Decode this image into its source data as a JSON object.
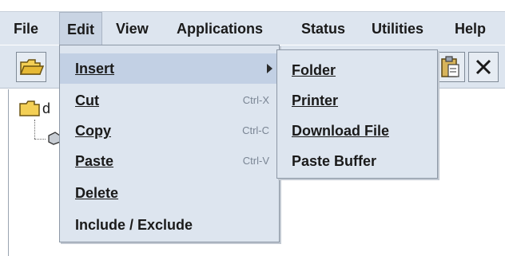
{
  "menubar": {
    "file": "File",
    "edit": "Edit",
    "view": "View",
    "applications": "Applications",
    "status": "Status",
    "utilities": "Utilities",
    "help": "Help"
  },
  "tree": {
    "root_label": "d"
  },
  "edit_menu": {
    "insert": "Insert",
    "cut": "Cut",
    "cut_shortcut": "Ctrl-X",
    "copy": "Copy",
    "copy_shortcut": "Ctrl-C",
    "paste": "Paste",
    "paste_shortcut": "Ctrl-V",
    "delete": "Delete",
    "include_exclude": "Include / Exclude"
  },
  "insert_submenu": {
    "folder": "Folder",
    "printer": "Printer",
    "download_file": "Download File",
    "paste_buffer": "Paste Buffer"
  },
  "colors": {
    "menu_bg": "#dde5ef",
    "highlight": "#c2d0e4",
    "shortcut_text": "#7a8594"
  }
}
